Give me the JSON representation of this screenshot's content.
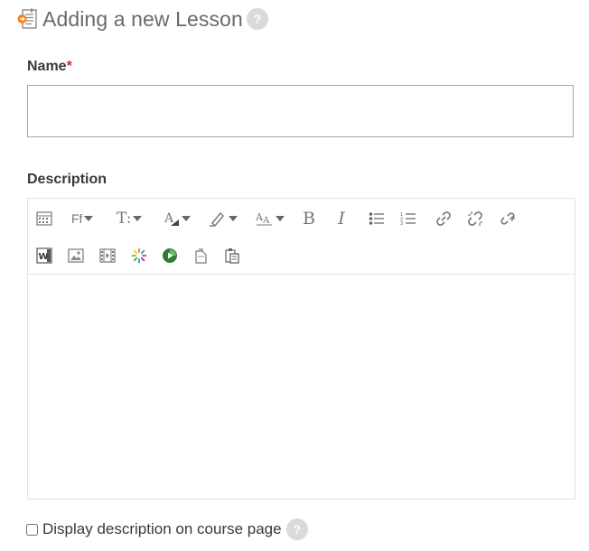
{
  "header": {
    "title": "Adding a new Lesson",
    "help_icon": "help-icon",
    "help_glyph": "?"
  },
  "form": {
    "name_label": "Name",
    "required_mark": "*",
    "name_value": "",
    "description_label": "Description",
    "display_description_label": "Display description on course page",
    "display_description_checked": false
  },
  "toolbar": {
    "row1": [
      {
        "name": "toolbar-toggle-icon"
      },
      {
        "name": "font-family-icon",
        "text": "Ff",
        "dropdown": true
      },
      {
        "name": "font-size-icon",
        "text": "T:",
        "dropdown": true
      },
      {
        "name": "font-color-icon",
        "dropdown": true
      },
      {
        "name": "highlight-color-icon",
        "dropdown": true
      },
      {
        "name": "paragraph-style-icon",
        "dropdown": true
      },
      {
        "name": "bold-icon",
        "text": "B"
      },
      {
        "name": "italic-icon",
        "text": "I"
      },
      {
        "name": "unordered-list-icon"
      },
      {
        "name": "ordered-list-icon"
      },
      {
        "name": "link-icon"
      },
      {
        "name": "unlink-icon"
      },
      {
        "name": "anchor-link-icon"
      }
    ],
    "row2": [
      {
        "name": "word-paste-icon"
      },
      {
        "name": "image-icon"
      },
      {
        "name": "media-icon"
      },
      {
        "name": "loader-icon"
      },
      {
        "name": "recording-icon"
      },
      {
        "name": "clipboard-icon"
      },
      {
        "name": "paste-icon"
      }
    ]
  },
  "colors": {
    "accent": "#f98012",
    "label": "#373a3c",
    "title": "#6a6a6a",
    "help_bg": "#dadada",
    "required": "#c9302c"
  }
}
